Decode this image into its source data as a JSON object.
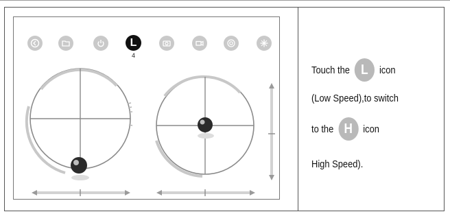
{
  "toolbar": {
    "icons": [
      {
        "name": "back-icon"
      },
      {
        "name": "folder-icon"
      },
      {
        "name": "power-icon"
      },
      {
        "name": "low-speed-icon",
        "letter": "L",
        "active": true,
        "sublabel": "4"
      },
      {
        "name": "camera-icon"
      },
      {
        "name": "video-icon"
      },
      {
        "name": "gyro-icon"
      },
      {
        "name": "compass-icon"
      }
    ]
  },
  "instructions": {
    "line1_pre": "Touch the",
    "badge_low": "L",
    "line1_post": "icon",
    "line2": "(Low Speed),to switch",
    "line3_pre": "to the",
    "badge_high": "H",
    "line3_post": "icon",
    "line4": "High Speed)."
  },
  "colors": {
    "badge": "#b9b9b9",
    "active_icon": "#111111",
    "inactive_icon": "#c9c9c9"
  }
}
